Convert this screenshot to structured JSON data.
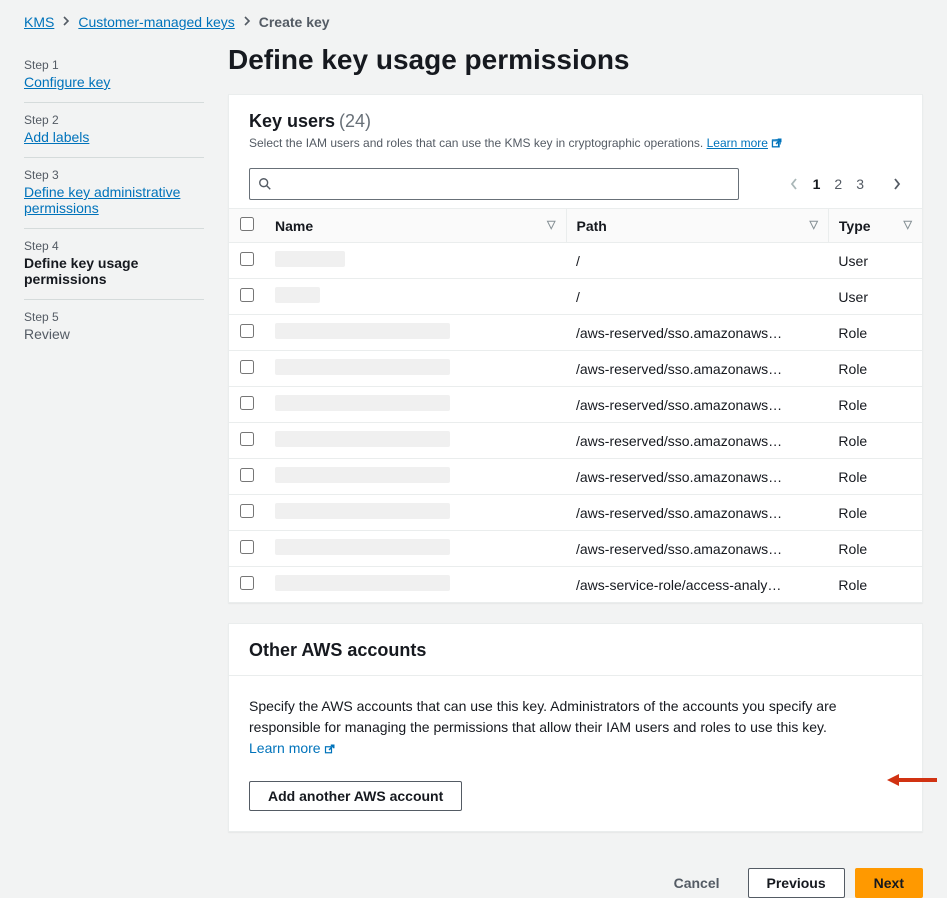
{
  "breadcrumb": {
    "items": [
      "KMS",
      "Customer-managed keys"
    ],
    "current": "Create key"
  },
  "sidebar": {
    "steps": [
      {
        "label": "Step 1",
        "title": "Configure key",
        "state": "link"
      },
      {
        "label": "Step 2",
        "title": "Add labels",
        "state": "link"
      },
      {
        "label": "Step 3",
        "title": "Define key administrative permissions",
        "state": "link"
      },
      {
        "label": "Step 4",
        "title": "Define key usage permissions",
        "state": "active"
      },
      {
        "label": "Step 5",
        "title": "Review",
        "state": "future"
      }
    ]
  },
  "page_title": "Define key usage permissions",
  "key_users": {
    "title": "Key users",
    "count": "(24)",
    "subtitle": "Select the IAM users and roles that can use the KMS key in cryptographic operations.",
    "learn_more": "Learn more",
    "search_placeholder": "",
    "pagination": {
      "pages": [
        "1",
        "2",
        "3"
      ],
      "active": "1"
    },
    "columns": {
      "name": "Name",
      "path": "Path",
      "type": "Type"
    },
    "rows": [
      {
        "name_hidden": "w1",
        "path": "/",
        "type": "User"
      },
      {
        "name_hidden": "w2",
        "path": "/",
        "type": "User"
      },
      {
        "name_hidden": "w3",
        "path": "/aws-reserved/sso.amazonaws…",
        "type": "Role"
      },
      {
        "name_hidden": "w3",
        "path": "/aws-reserved/sso.amazonaws…",
        "type": "Role"
      },
      {
        "name_hidden": "w3",
        "path": "/aws-reserved/sso.amazonaws…",
        "type": "Role"
      },
      {
        "name_hidden": "w3",
        "path": "/aws-reserved/sso.amazonaws…",
        "type": "Role"
      },
      {
        "name_hidden": "w3",
        "path": "/aws-reserved/sso.amazonaws…",
        "type": "Role"
      },
      {
        "name_hidden": "w3",
        "path": "/aws-reserved/sso.amazonaws…",
        "type": "Role"
      },
      {
        "name_hidden": "w3",
        "path": "/aws-reserved/sso.amazonaws…",
        "type": "Role"
      },
      {
        "name_hidden": "w3",
        "path": "/aws-service-role/access-analy…",
        "type": "Role"
      }
    ]
  },
  "other_accounts": {
    "title": "Other AWS accounts",
    "text": "Specify the AWS accounts that can use this key. Administrators of the accounts you specify are responsible for managing the permissions that allow their IAM users and roles to use this key.",
    "learn_more": "Learn more",
    "add_button": "Add another AWS account"
  },
  "footer": {
    "cancel": "Cancel",
    "previous": "Previous",
    "next": "Next"
  }
}
